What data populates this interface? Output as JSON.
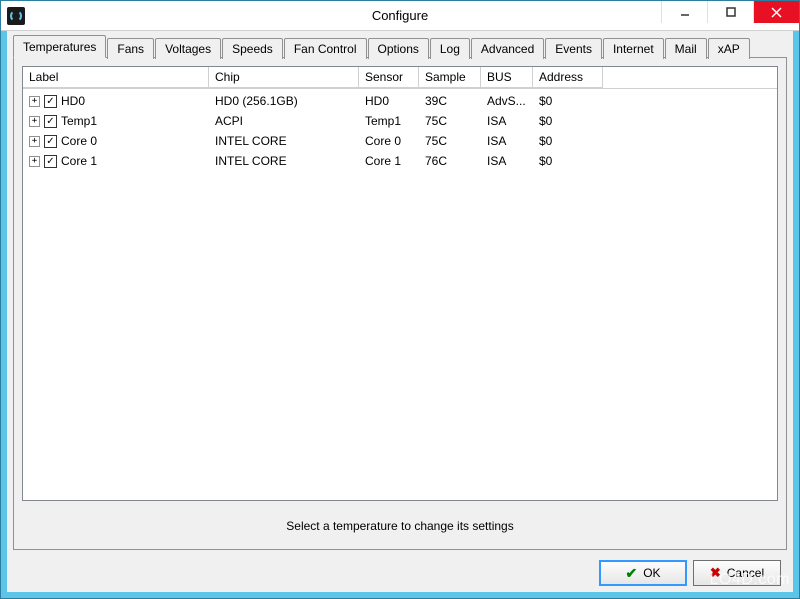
{
  "window": {
    "title": "Configure"
  },
  "tabs": {
    "temperatures": "Temperatures",
    "fans": "Fans",
    "voltages": "Voltages",
    "speeds": "Speeds",
    "fan_control": "Fan Control",
    "options": "Options",
    "log": "Log",
    "advanced": "Advanced",
    "events": "Events",
    "internet": "Internet",
    "mail": "Mail",
    "xap": "xAP"
  },
  "columns": {
    "label": "Label",
    "chip": "Chip",
    "sensor": "Sensor",
    "sample": "Sample",
    "bus": "BUS",
    "address": "Address"
  },
  "rows": [
    {
      "label": "HD0",
      "chip": "HD0 (256.1GB)",
      "sensor": "HD0",
      "sample": "39C",
      "bus": "AdvS...",
      "address": "$0"
    },
    {
      "label": "Temp1",
      "chip": "ACPI",
      "sensor": "Temp1",
      "sample": "75C",
      "bus": "ISA",
      "address": "$0"
    },
    {
      "label": "Core 0",
      "chip": "INTEL CORE",
      "sensor": "Core 0",
      "sample": "75C",
      "bus": "ISA",
      "address": "$0"
    },
    {
      "label": "Core 1",
      "chip": "INTEL CORE",
      "sensor": "Core 1",
      "sample": "76C",
      "bus": "ISA",
      "address": "$0"
    }
  ],
  "hint": "Select a temperature to change its settings",
  "buttons": {
    "ok": "OK",
    "cancel": "Cancel"
  },
  "watermark": "LO4D.com"
}
